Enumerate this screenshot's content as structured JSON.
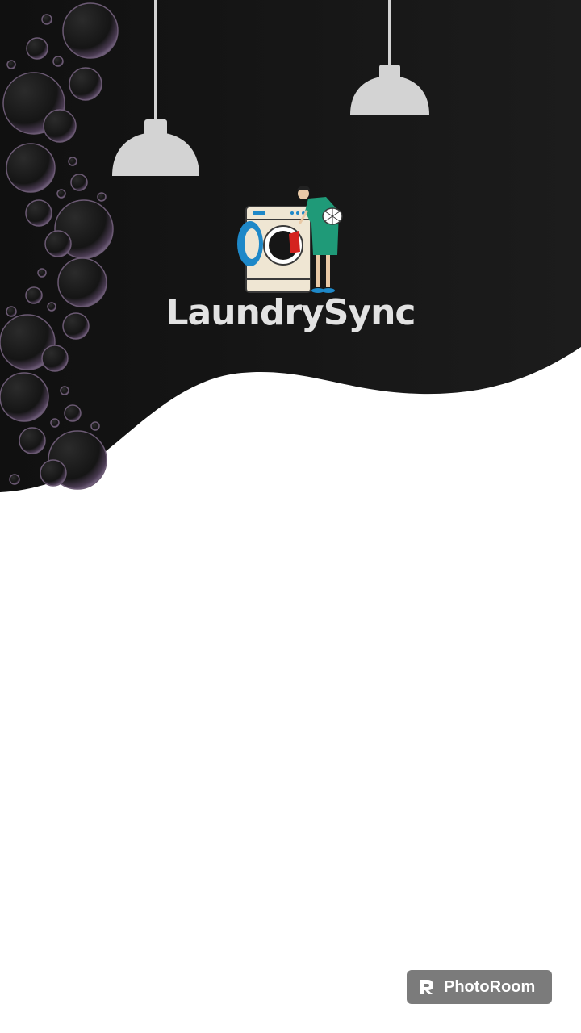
{
  "app": {
    "name": "LaundrySync",
    "logo_icon": "washing-machine-person-icon"
  },
  "hero": {
    "background_color": "#161616",
    "lamp_color": "#d3d3d3",
    "decor_icons": [
      "pendant-lamp-icon",
      "pendant-lamp-icon",
      "soap-bubbles-decoration"
    ]
  },
  "watermark": {
    "label": "PhotoRoom",
    "icon": "photoroom-logo-icon",
    "background_color": "#7b7b7b"
  }
}
